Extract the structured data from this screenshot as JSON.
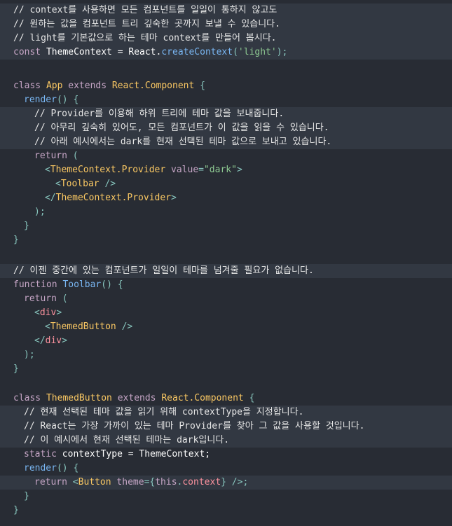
{
  "colors": {
    "background": "#282c34",
    "highlight": "#323842",
    "comment": "#e6e6e6",
    "keyword": "#c5a5c5",
    "class": "#fac863",
    "function": "#79b6f2",
    "string": "#8dc891",
    "tag": "#fc929e",
    "punct": "#88c6be",
    "plain": "#ffffff"
  },
  "lines": [
    {
      "hl": true,
      "indent": 0,
      "tokens": [
        {
          "t": "comment",
          "v": "// context를 사용하면 모든 컴포넌트를 일일이 통하지 않고도"
        }
      ]
    },
    {
      "hl": true,
      "indent": 0,
      "tokens": [
        {
          "t": "comment",
          "v": "// 원하는 값을 컴포넌트 트리 깊숙한 곳까지 보낼 수 있습니다."
        }
      ]
    },
    {
      "hl": true,
      "indent": 0,
      "tokens": [
        {
          "t": "comment",
          "v": "// light를 기본값으로 하는 테마 context를 만들어 봅시다."
        }
      ]
    },
    {
      "hl": true,
      "indent": 0,
      "tokens": [
        {
          "t": "keyword",
          "v": "const "
        },
        {
          "t": "plain",
          "v": "ThemeContext = React."
        },
        {
          "t": "func",
          "v": "createContext"
        },
        {
          "t": "punct",
          "v": "("
        },
        {
          "t": "string",
          "v": "'light'"
        },
        {
          "t": "punct",
          "v": ");"
        }
      ]
    },
    {
      "hl": false,
      "indent": 0,
      "tokens": []
    },
    {
      "hl": false,
      "indent": 0,
      "tokens": [
        {
          "t": "keyword",
          "v": "class "
        },
        {
          "t": "class",
          "v": "App "
        },
        {
          "t": "keyword",
          "v": "extends "
        },
        {
          "t": "class",
          "v": "React.Component "
        },
        {
          "t": "punct",
          "v": "{"
        }
      ]
    },
    {
      "hl": false,
      "indent": 1,
      "tokens": [
        {
          "t": "func",
          "v": "render"
        },
        {
          "t": "punct",
          "v": "() {"
        }
      ]
    },
    {
      "hl": true,
      "indent": 2,
      "tokens": [
        {
          "t": "comment",
          "v": "// Provider를 이용해 하위 트리에 테마 값을 보내줍니다."
        }
      ]
    },
    {
      "hl": true,
      "indent": 2,
      "tokens": [
        {
          "t": "comment",
          "v": "// 아무리 깊숙히 있어도, 모든 컴포넌트가 이 값을 읽을 수 있습니다."
        }
      ]
    },
    {
      "hl": true,
      "indent": 2,
      "tokens": [
        {
          "t": "comment",
          "v": "// 아래 예시에서는 dark를 현재 선택된 테마 값으로 보내고 있습니다."
        }
      ]
    },
    {
      "hl": false,
      "indent": 2,
      "tokens": [
        {
          "t": "keyword",
          "v": "return "
        },
        {
          "t": "punct",
          "v": "("
        }
      ]
    },
    {
      "hl": false,
      "indent": 3,
      "tokens": [
        {
          "t": "punct",
          "v": "<"
        },
        {
          "t": "class",
          "v": "ThemeContext.Provider "
        },
        {
          "t": "attr",
          "v": "value"
        },
        {
          "t": "punct",
          "v": "="
        },
        {
          "t": "string",
          "v": "\"dark\""
        },
        {
          "t": "punct",
          "v": ">"
        }
      ]
    },
    {
      "hl": false,
      "indent": 4,
      "tokens": [
        {
          "t": "punct",
          "v": "<"
        },
        {
          "t": "class",
          "v": "Toolbar "
        },
        {
          "t": "punct",
          "v": "/>"
        }
      ]
    },
    {
      "hl": false,
      "indent": 3,
      "tokens": [
        {
          "t": "punct",
          "v": "</"
        },
        {
          "t": "class",
          "v": "ThemeContext.Provider"
        },
        {
          "t": "punct",
          "v": ">"
        }
      ]
    },
    {
      "hl": false,
      "indent": 2,
      "tokens": [
        {
          "t": "punct",
          "v": ");"
        }
      ]
    },
    {
      "hl": false,
      "indent": 1,
      "tokens": [
        {
          "t": "punct",
          "v": "}"
        }
      ]
    },
    {
      "hl": false,
      "indent": 0,
      "tokens": [
        {
          "t": "punct",
          "v": "}"
        }
      ]
    },
    {
      "hl": false,
      "indent": 0,
      "tokens": []
    },
    {
      "hl": true,
      "indent": 0,
      "tokens": [
        {
          "t": "comment",
          "v": "// 이젠 중간에 있는 컴포넌트가 일일이 테마를 넘겨줄 필요가 없습니다."
        }
      ]
    },
    {
      "hl": false,
      "indent": 0,
      "tokens": [
        {
          "t": "keyword",
          "v": "function "
        },
        {
          "t": "func",
          "v": "Toolbar"
        },
        {
          "t": "punct",
          "v": "() {"
        }
      ]
    },
    {
      "hl": false,
      "indent": 1,
      "tokens": [
        {
          "t": "keyword",
          "v": "return "
        },
        {
          "t": "punct",
          "v": "("
        }
      ]
    },
    {
      "hl": false,
      "indent": 2,
      "tokens": [
        {
          "t": "punct",
          "v": "<"
        },
        {
          "t": "tag",
          "v": "div"
        },
        {
          "t": "punct",
          "v": ">"
        }
      ]
    },
    {
      "hl": false,
      "indent": 3,
      "tokens": [
        {
          "t": "punct",
          "v": "<"
        },
        {
          "t": "class",
          "v": "ThemedButton "
        },
        {
          "t": "punct",
          "v": "/>"
        }
      ]
    },
    {
      "hl": false,
      "indent": 2,
      "tokens": [
        {
          "t": "punct",
          "v": "</"
        },
        {
          "t": "tag",
          "v": "div"
        },
        {
          "t": "punct",
          "v": ">"
        }
      ]
    },
    {
      "hl": false,
      "indent": 1,
      "tokens": [
        {
          "t": "punct",
          "v": ");"
        }
      ]
    },
    {
      "hl": false,
      "indent": 0,
      "tokens": [
        {
          "t": "punct",
          "v": "}"
        }
      ]
    },
    {
      "hl": false,
      "indent": 0,
      "tokens": []
    },
    {
      "hl": false,
      "indent": 0,
      "tokens": [
        {
          "t": "keyword",
          "v": "class "
        },
        {
          "t": "class",
          "v": "ThemedButton "
        },
        {
          "t": "keyword",
          "v": "extends "
        },
        {
          "t": "class",
          "v": "React.Component "
        },
        {
          "t": "punct",
          "v": "{"
        }
      ]
    },
    {
      "hl": true,
      "indent": 1,
      "tokens": [
        {
          "t": "comment",
          "v": "// 현재 선택된 테마 값을 읽기 위해 contextType을 지정합니다."
        }
      ]
    },
    {
      "hl": true,
      "indent": 1,
      "tokens": [
        {
          "t": "comment",
          "v": "// React는 가장 가까이 있는 테마 Provider를 찾아 그 값을 사용할 것입니다."
        }
      ]
    },
    {
      "hl": true,
      "indent": 1,
      "tokens": [
        {
          "t": "comment",
          "v": "// 이 예시에서 현재 선택된 테마는 dark입니다."
        }
      ]
    },
    {
      "hl": false,
      "indent": 1,
      "tokens": [
        {
          "t": "keyword",
          "v": "static "
        },
        {
          "t": "plain",
          "v": "contextType = ThemeContext;"
        }
      ]
    },
    {
      "hl": false,
      "indent": 1,
      "tokens": [
        {
          "t": "func",
          "v": "render"
        },
        {
          "t": "punct",
          "v": "() {"
        }
      ]
    },
    {
      "hl": true,
      "indent": 2,
      "tokens": [
        {
          "t": "keyword",
          "v": "return "
        },
        {
          "t": "punct",
          "v": "<"
        },
        {
          "t": "class",
          "v": "Button "
        },
        {
          "t": "attr",
          "v": "theme"
        },
        {
          "t": "punct",
          "v": "={"
        },
        {
          "t": "keyword",
          "v": "this"
        },
        {
          "t": "punct",
          "v": "."
        },
        {
          "t": "tag",
          "v": "context"
        },
        {
          "t": "punct",
          "v": "} />;"
        }
      ]
    },
    {
      "hl": false,
      "indent": 1,
      "tokens": [
        {
          "t": "punct",
          "v": "}"
        }
      ]
    },
    {
      "hl": false,
      "indent": 0,
      "tokens": [
        {
          "t": "punct",
          "v": "}"
        }
      ]
    }
  ]
}
